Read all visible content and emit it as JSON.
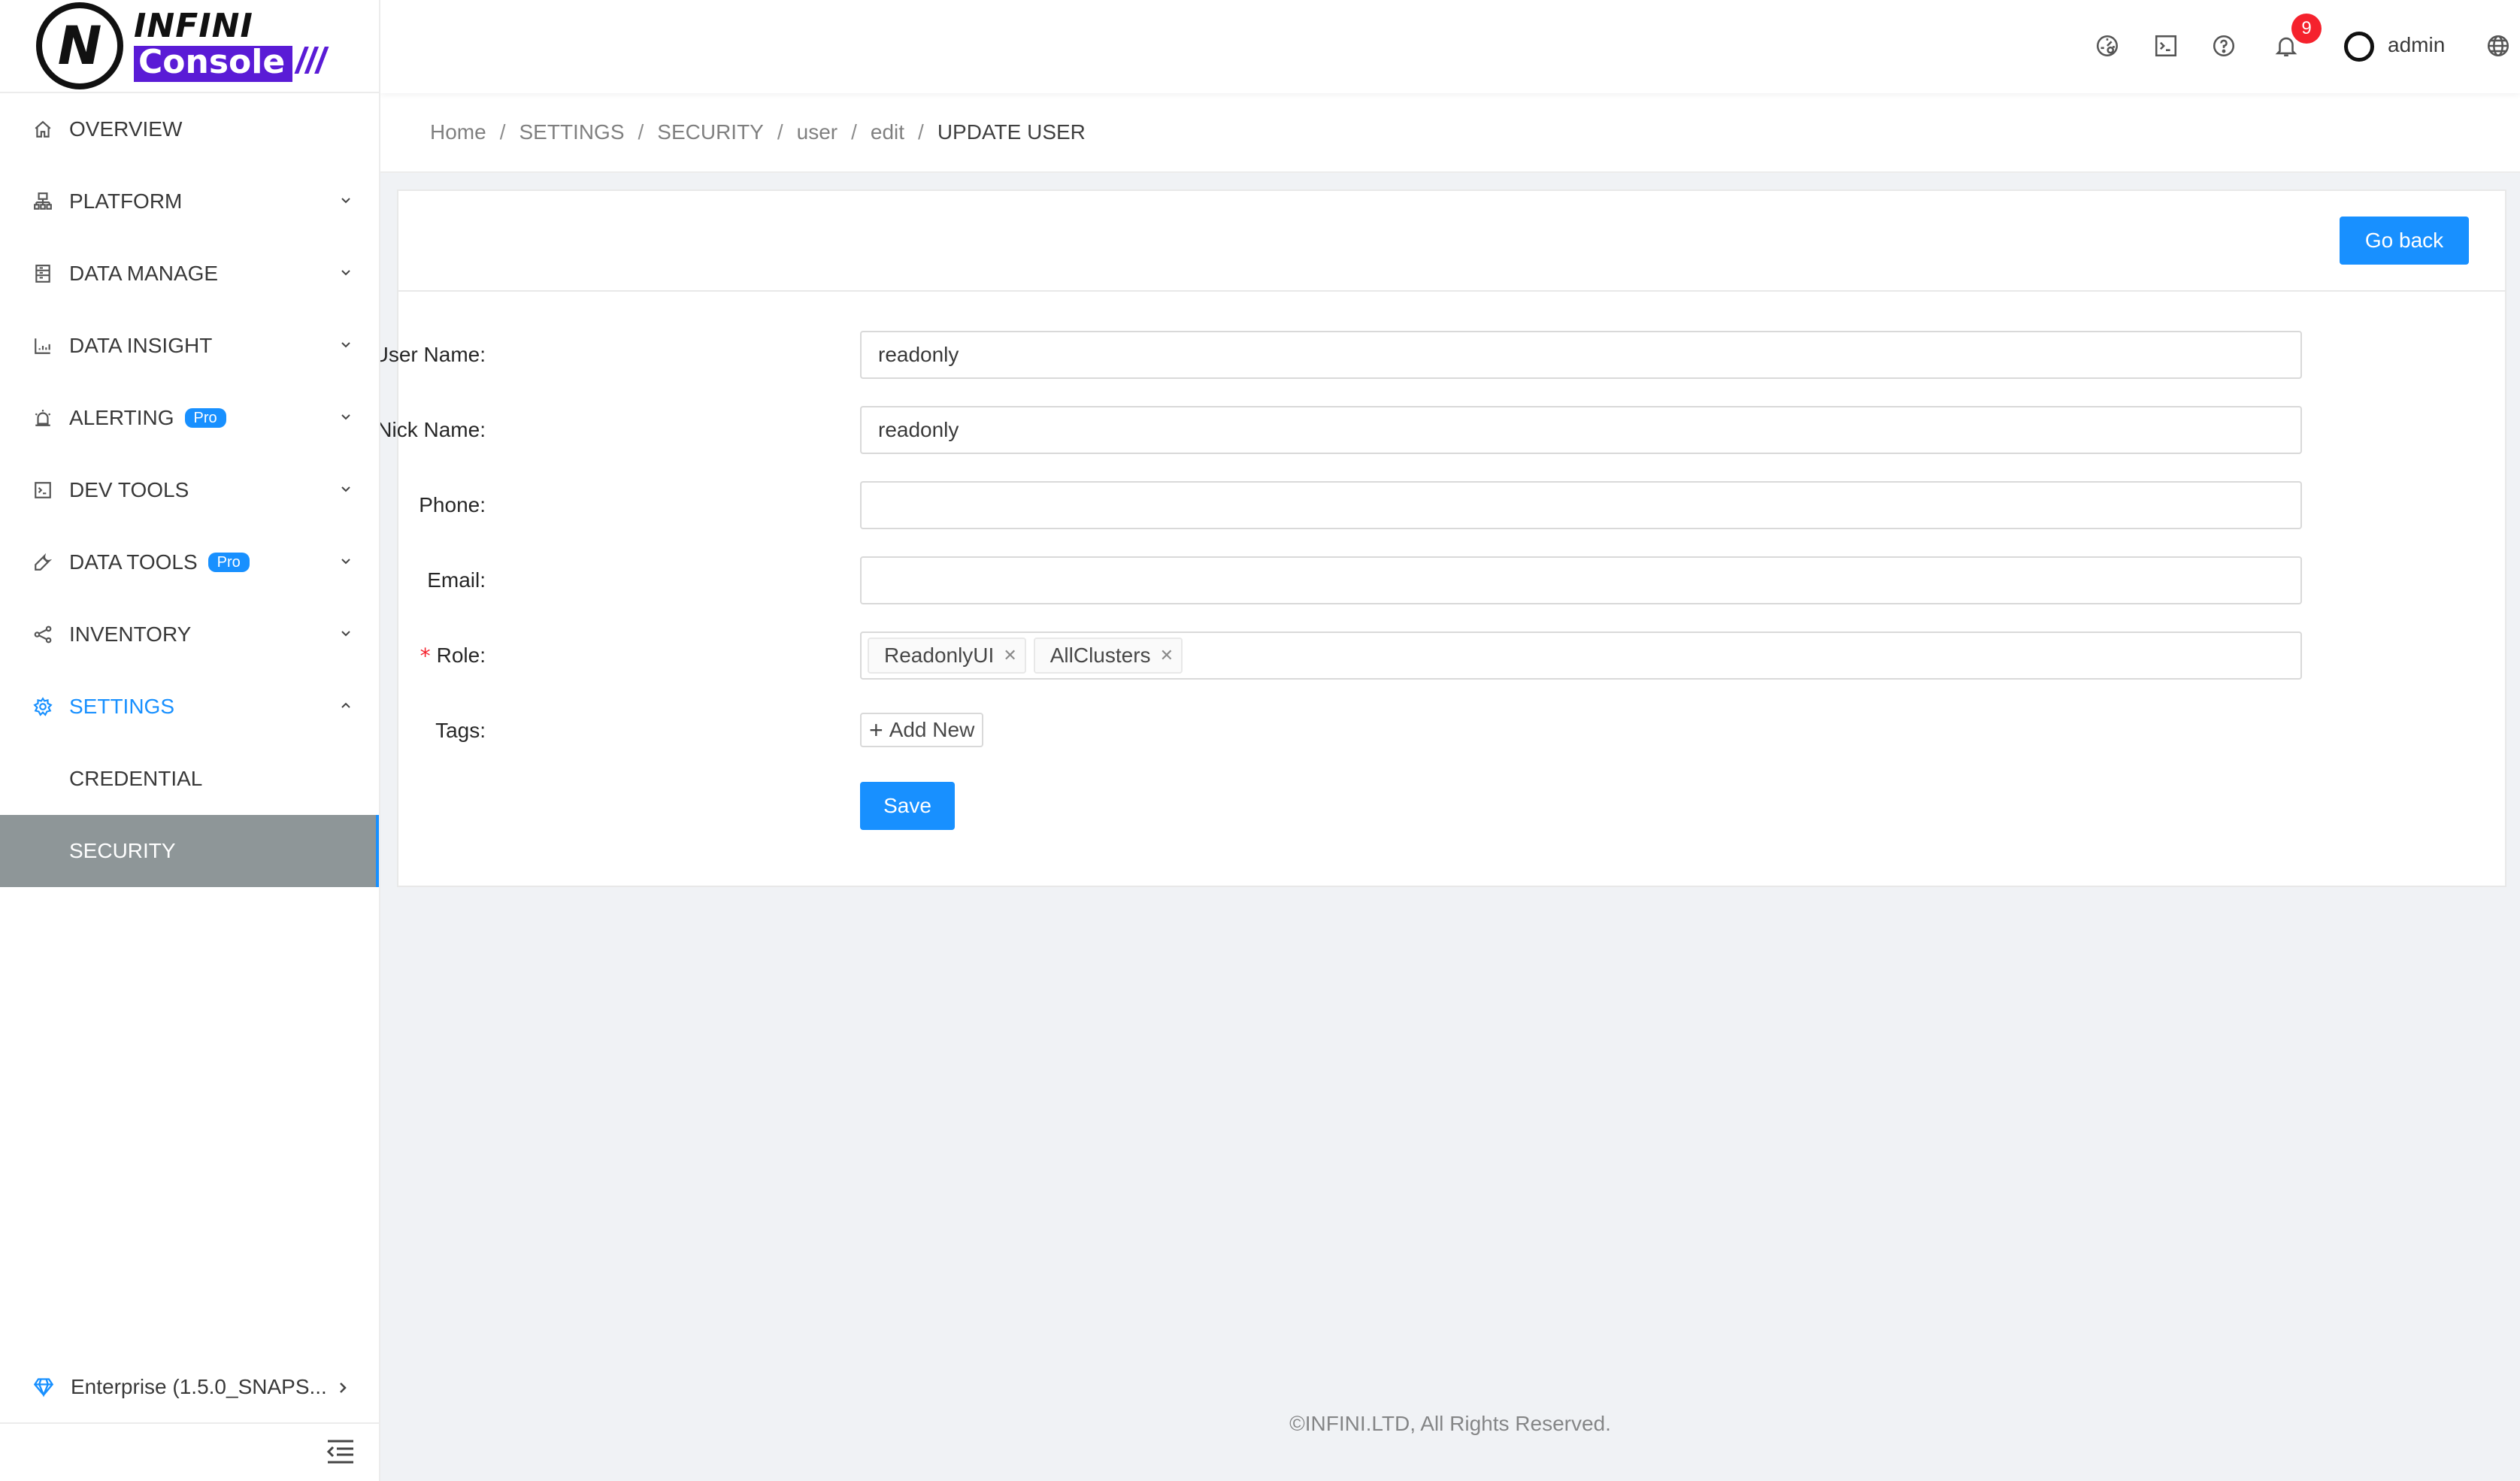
{
  "brand": {
    "logo_top": "INFINI",
    "logo_bottom": "Console",
    "logo_slashes": "///"
  },
  "sidebar": {
    "items": [
      {
        "label": "OVERVIEW",
        "icon": "home-icon"
      },
      {
        "label": "PLATFORM",
        "icon": "platform-icon"
      },
      {
        "label": "DATA MANAGE",
        "icon": "database-icon"
      },
      {
        "label": "DATA INSIGHT",
        "icon": "chart-icon"
      },
      {
        "label": "ALERTING",
        "icon": "alarm-icon",
        "badge": "Pro"
      },
      {
        "label": "DEV TOOLS",
        "icon": "terminal-icon"
      },
      {
        "label": "DATA TOOLS",
        "icon": "wrench-icon",
        "badge": "Pro"
      },
      {
        "label": "INVENTORY",
        "icon": "share-icon"
      },
      {
        "label": "SETTINGS",
        "icon": "gear-icon"
      }
    ],
    "sub_items": [
      {
        "label": "CREDENTIAL"
      },
      {
        "label": "SECURITY"
      }
    ],
    "enterprise_label": "Enterprise (1.5.0_SNAPS...",
    "accent_color": "#1890ff",
    "selected_bg": "#8e9698"
  },
  "header": {
    "notification_count": "9",
    "user_name": "admin"
  },
  "breadcrumb": [
    "Home",
    "SETTINGS",
    "SECURITY",
    "user",
    "edit",
    "UPDATE USER"
  ],
  "card": {
    "go_back_label": "Go back"
  },
  "form": {
    "user_name": {
      "label": "User Name",
      "value": "readonly",
      "required": true
    },
    "nick_name": {
      "label": "Nick Name",
      "value": "readonly"
    },
    "phone": {
      "label": "Phone",
      "value": ""
    },
    "email": {
      "label": "Email",
      "value": ""
    },
    "role": {
      "label": "Role",
      "required": true,
      "tags": [
        "ReadonlyUI",
        "AllClusters"
      ]
    },
    "tags": {
      "label": "Tags",
      "add_label": "Add New"
    },
    "save_label": "Save",
    "colon": ":"
  },
  "footer": {
    "copyright": "©INFINI.LTD, All Rights Reserved."
  }
}
